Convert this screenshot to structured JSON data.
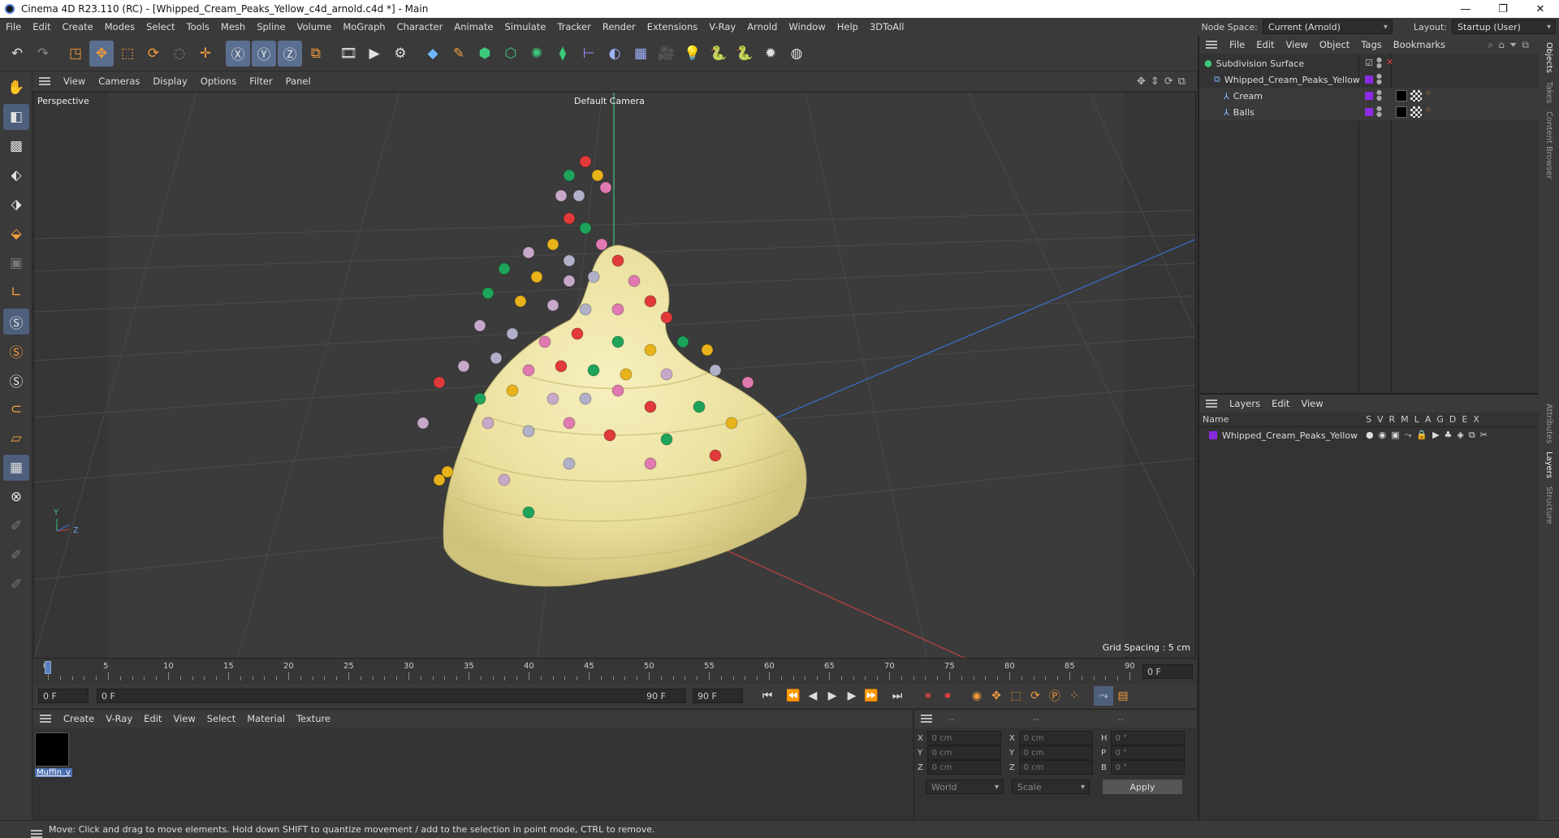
{
  "window": {
    "title": "Cinema 4D R23.110 (RC) - [Whipped_Cream_Peaks_Yellow_c4d_arnold.c4d *] - Main",
    "minimize": "—",
    "maximize": "❐",
    "close": "✕"
  },
  "menubar": {
    "items": [
      "File",
      "Edit",
      "Create",
      "Modes",
      "Select",
      "Tools",
      "Mesh",
      "Spline",
      "Volume",
      "MoGraph",
      "Character",
      "Animate",
      "Simulate",
      "Tracker",
      "Render",
      "Extensions",
      "V-Ray",
      "Arnold",
      "Window",
      "Help",
      "3DToAll"
    ],
    "node_space_label": "Node Space:",
    "node_space_value": "Current (Arnold)",
    "layout_label": "Layout:",
    "layout_value": "Startup (User)"
  },
  "viewport": {
    "menu": [
      "View",
      "Cameras",
      "Display",
      "Options",
      "Filter",
      "Panel"
    ],
    "label": "Perspective",
    "camera": "Default Camera",
    "grid_spacing": "Grid Spacing : 5 cm",
    "axis_y": "Y",
    "axis_z": "Z"
  },
  "timeline": {
    "ticks": [
      "0",
      "5",
      "10",
      "15",
      "20",
      "25",
      "30",
      "35",
      "40",
      "45",
      "50",
      "55",
      "60",
      "65",
      "70",
      "75",
      "80",
      "85",
      "90"
    ],
    "current_frame_field": "0 F",
    "start_field": "0 F",
    "range_start": "0 F",
    "range_end": "90 F",
    "end_field": "90 F",
    "frame_display": "0 F"
  },
  "materials": {
    "menu": [
      "Create",
      "V-Ray",
      "Edit",
      "View",
      "Select",
      "Material",
      "Texture"
    ],
    "items": [
      {
        "name": "Muffin_v"
      }
    ]
  },
  "coords": {
    "headers": [
      "--",
      "--",
      "--"
    ],
    "rows": [
      {
        "a": "X",
        "av": "0 cm",
        "b": "X",
        "bv": "0 cm",
        "c": "H",
        "cv": "0 °"
      },
      {
        "a": "Y",
        "av": "0 cm",
        "b": "Y",
        "bv": "0 cm",
        "c": "P",
        "cv": "0 °"
      },
      {
        "a": "Z",
        "av": "0 cm",
        "b": "Z",
        "bv": "0 cm",
        "c": "B",
        "cv": "0 °"
      }
    ],
    "mode": "World",
    "scale": "Scale",
    "apply": "Apply"
  },
  "objects": {
    "menu": [
      "File",
      "Edit",
      "View",
      "Object",
      "Tags",
      "Bookmarks"
    ],
    "tree": [
      {
        "name": "Subdivision Surface",
        "indent": 0
      },
      {
        "name": "Whipped_Cream_Peaks_Yellow",
        "indent": 1
      },
      {
        "name": "Cream",
        "indent": 2
      },
      {
        "name": "Balls",
        "indent": 2
      }
    ]
  },
  "layers": {
    "menu": [
      "Layers",
      "Edit",
      "View"
    ],
    "columns": [
      "Name",
      "S",
      "V",
      "R",
      "M",
      "L",
      "A",
      "G",
      "D",
      "E",
      "X"
    ],
    "rows": [
      {
        "name": "Whipped_Cream_Peaks_Yellow",
        "color": "#8a2be2"
      }
    ]
  },
  "side_tabs": [
    "Objects",
    "Takes",
    "Content Browser",
    "Attributes",
    "Layers",
    "Structure"
  ],
  "status": "Move: Click and drag to move elements. Hold down SHIFT to quantize movement / add to the selection in point mode, CTRL to remove.",
  "colors": {
    "accent": "#5a6e90",
    "layer_purple": "#8a2be2",
    "cream": "#efe7a8",
    "green_axis": "#3fbf7f",
    "blue_axis": "#3a6fd0",
    "red_axis": "#c04040"
  }
}
